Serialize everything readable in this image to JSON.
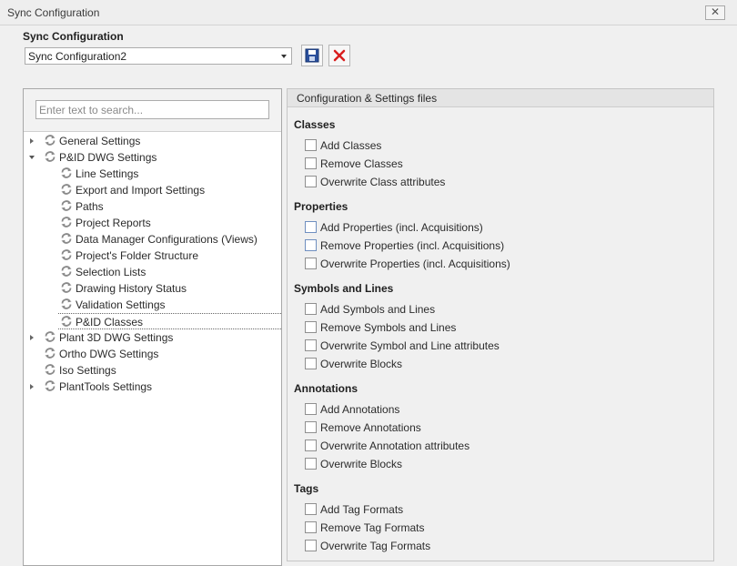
{
  "window": {
    "title": "Sync Configuration",
    "close_glyph": "✕"
  },
  "header": {
    "section_label": "Sync Configuration",
    "selected_config": "Sync Configuration2"
  },
  "search": {
    "placeholder": "Enter text to search..."
  },
  "tree": {
    "items": [
      {
        "label": "General Settings",
        "arrow": "collapsed"
      },
      {
        "label": "P&ID DWG Settings",
        "arrow": "expanded"
      },
      {
        "label": "Line Settings"
      },
      {
        "label": "Export and Import Settings"
      },
      {
        "label": "Paths"
      },
      {
        "label": "Project Reports"
      },
      {
        "label": "Data Manager Configurations (Views)"
      },
      {
        "label": "Project's Folder Structure"
      },
      {
        "label": "Selection Lists"
      },
      {
        "label": "Drawing History Status"
      },
      {
        "label": "Validation Settings"
      },
      {
        "label": "P&ID Classes",
        "selected": true
      },
      {
        "label": "Plant 3D DWG Settings",
        "arrow": "collapsed"
      },
      {
        "label": "Ortho DWG Settings"
      },
      {
        "label": "Iso Settings"
      },
      {
        "label": "PlantTools Settings",
        "arrow": "collapsed"
      }
    ]
  },
  "config_panel": {
    "title": "Configuration & Settings files",
    "groups": [
      {
        "heading": "Classes",
        "options": [
          "Add Classes",
          "Remove Classes",
          "Overwrite Class attributes"
        ]
      },
      {
        "heading": "Properties",
        "options": [
          "Add Properties (incl. Acquisitions)",
          "Remove Properties (incl. Acquisitions)",
          "Overwrite Properties (incl. Acquisitions)"
        ]
      },
      {
        "heading": "Symbols and Lines",
        "options": [
          "Add Symbols and Lines",
          "Remove Symbols and Lines",
          "Overwrite Symbol and Line attributes",
          "Overwrite Blocks"
        ]
      },
      {
        "heading": "Annotations",
        "options": [
          "Add Annotations",
          "Remove Annotations",
          "Overwrite Annotation attributes",
          "Overwrite Blocks"
        ]
      },
      {
        "heading": "Tags",
        "options": [
          "Add Tag Formats",
          "Remove Tag Formats",
          "Overwrite Tag Formats"
        ]
      }
    ]
  },
  "colors": {
    "save_icon": "#2a4f9c",
    "delete_icon": "#d81e1e",
    "sync_icon": "#8a8a8a"
  }
}
